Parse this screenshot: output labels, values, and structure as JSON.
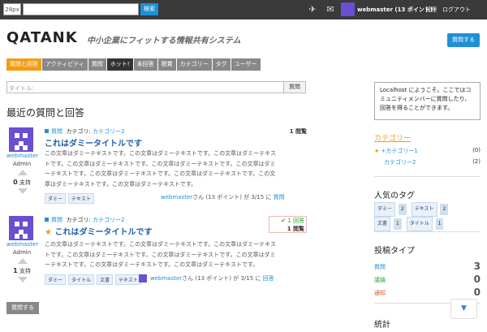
{
  "topbar": {
    "logo": "28px",
    "search_placeholder": "",
    "search_button": "検索",
    "username": "webmaster (13 ポイント)",
    "admin": "管理",
    "logout": "ログアウト"
  },
  "header": {
    "title": "QATANK",
    "subtitle": "中小企業にフィットする情報共有システム",
    "ask_button": "質問する"
  },
  "tabs": [
    "質問と回答",
    "アクティビティ",
    "質問",
    "ホット!",
    "未回答",
    "懸賞",
    "カテゴリー",
    "タグ",
    "ユーザー"
  ],
  "title_field": {
    "placeholder": "タイトル:",
    "button": "質問"
  },
  "section_title": "最近の質問と回答",
  "questions": [
    {
      "type": "質問",
      "category_label": "カテゴリ:",
      "category": "カテゴリー2",
      "views": "1 閲覧",
      "title": "これはダミータイトルです",
      "user": "webmaster",
      "role": "Admin",
      "votes": "0",
      "votes_label": "支持",
      "body": "この文章はダミーテキストです。この文章はダミーテキストです。この文章はダミーテキストです。この文章はダミーテキストです。この文章はダミーテキストです。この文章はダミーテキストです。この文章はダミーテキストです。この文章はダミーテキストです。この文章はダミーテキストです。この文章はダミーテキストです。",
      "tags": [
        "ダミー",
        "テキスト"
      ],
      "byline_user": "webmaster",
      "byline_rest": "さん (13 ポイント) が 3/15 に",
      "byline_action": "質問"
    },
    {
      "type": "質問",
      "category_label": "カテゴリ:",
      "category": "カテゴリー2",
      "answers": "1 回答",
      "views": "1 閲覧",
      "title": "これはダミータイトルです",
      "user": "webmaster",
      "role": "Admin",
      "votes": "1",
      "votes_label": "支持",
      "body": "この文章はダミーテキストです。この文章はダミーテキストです。この文章はダミーテキストです。この文章はダミーテキストです。この文章はダミーテキストです。この文章はダミーテキストです。この文章はダミーテキストです。この文章はダミーテキストです。",
      "tags": [
        "ダミー",
        "タイトル",
        "文書",
        "テキスト"
      ],
      "byline_user": "webmaster",
      "byline_rest": "さん (13 ポイント) が 3/15 に",
      "byline_action": "回答"
    }
  ],
  "ask_bottom": "質問する",
  "sidebar": {
    "welcome": "Localhost にようこそ。ここではコミュニティメンバーに質問したり、回答を得ることができます。",
    "categories_head": "カテゴリー",
    "categories": [
      {
        "name": "+カテゴリー1",
        "count": "(0)"
      },
      {
        "name": "カテゴリー2",
        "count": "(2)"
      }
    ],
    "tags_head": "人気のタグ",
    "tags": [
      {
        "name": "ダミー",
        "count": "2"
      },
      {
        "name": "テキスト",
        "count": "2"
      },
      {
        "name": "文書",
        "count": "1"
      },
      {
        "name": "タイトル",
        "count": "1"
      }
    ],
    "types_head": "投稿タイプ",
    "types": [
      {
        "name": "質問",
        "count": "3",
        "color": "#1e90d6"
      },
      {
        "name": "議論",
        "count": "0",
        "color": "#2aa52a"
      },
      {
        "name": "通知",
        "count": "0",
        "color": "#d9531e"
      }
    ],
    "stats_head": "統計"
  }
}
